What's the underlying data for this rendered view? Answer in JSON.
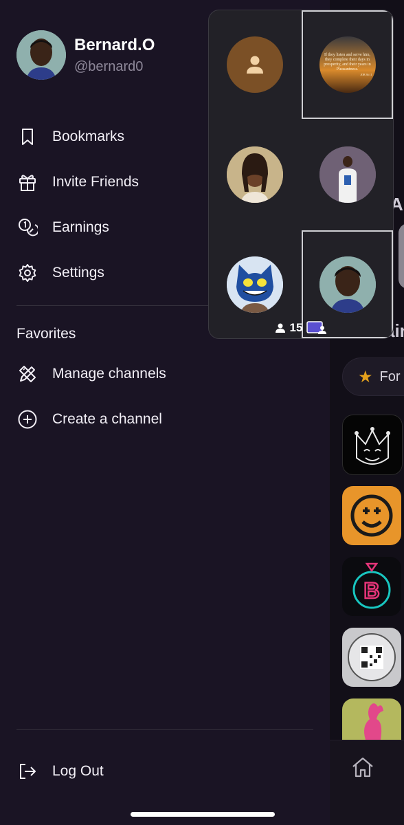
{
  "profile": {
    "name": "Bernard.O",
    "handle": "@bernard0"
  },
  "menu": [
    {
      "label": "Bookmarks",
      "icon": "bookmark-icon"
    },
    {
      "label": "Invite Friends",
      "icon": "gift-icon"
    },
    {
      "label": "Earnings",
      "icon": "coins-icon"
    },
    {
      "label": "Settings",
      "icon": "gear-icon"
    }
  ],
  "favorites": {
    "label": "Favorites",
    "items": [
      {
        "label": "Manage channels",
        "icon": "pencil-ruler-icon"
      },
      {
        "label": "Create a channel",
        "icon": "plus-circle-icon"
      }
    ]
  },
  "logout": {
    "label": "Log Out",
    "icon": "logout-icon"
  },
  "call": {
    "participant_count": "15",
    "verse_text": "If they listen and serve him, they complete their days in prosperity, and their years in Pleasantness.",
    "verse_ref": "JOB 36:11"
  },
  "background": {
    "partial_letters": [
      "Ap",
      "ain"
    ],
    "tab_label": "For"
  },
  "colors": {
    "drawer_bg": "#1a1424",
    "text": "#f2eff6",
    "muted": "#8e8899",
    "accent_star": "#e3a01c",
    "call_bg": "#222127"
  }
}
